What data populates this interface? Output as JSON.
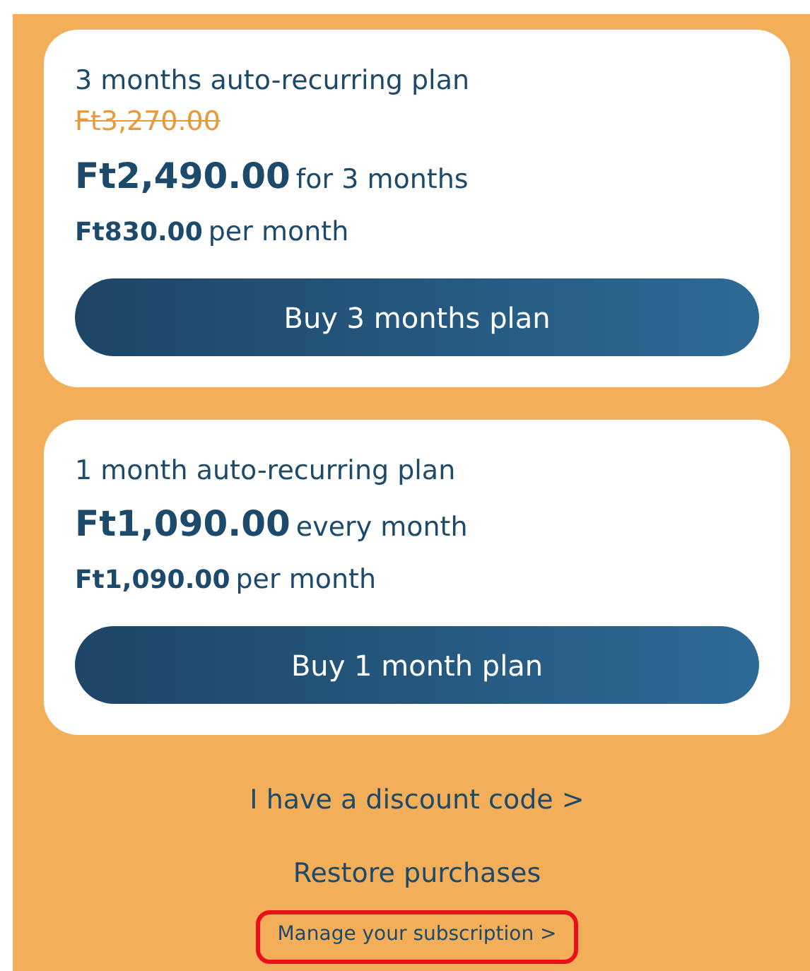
{
  "plans": [
    {
      "title": "3 months auto-recurring plan",
      "original_price": "Ft3,270.00",
      "price": "Ft2,490.00",
      "price_note": "for 3 months",
      "monthly_price": "Ft830.00",
      "monthly_note": "per month",
      "button": "Buy 3 months plan"
    },
    {
      "title": "1 month auto-recurring plan",
      "price": "Ft1,090.00",
      "price_note": "every month",
      "monthly_price": "Ft1,090.00",
      "monthly_note": "per month",
      "button": "Buy 1 month plan"
    }
  ],
  "links": [
    {
      "kind": "large",
      "label": "I have a discount code >",
      "highlighted": false
    },
    {
      "kind": "large",
      "label": "Restore purchases",
      "highlighted": false
    },
    {
      "kind": "small",
      "label": "Manage your subscription >",
      "highlighted": true
    }
  ]
}
